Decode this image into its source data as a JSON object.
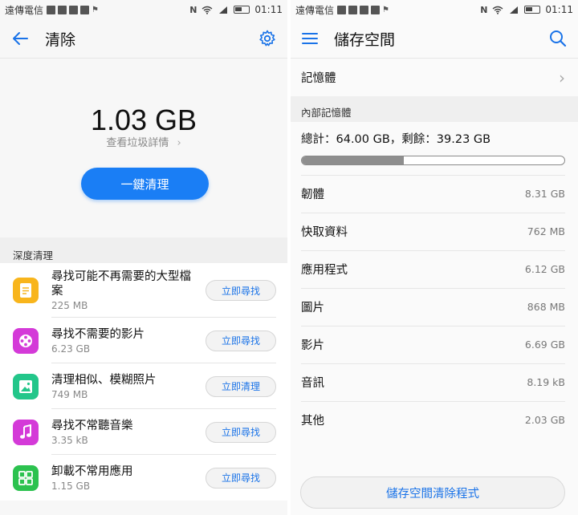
{
  "left_screen": {
    "status": {
      "carrier": "遠傳電信",
      "time": "01:11"
    },
    "appbar": {
      "title": "清除"
    },
    "summary": {
      "junk_size": "1.03 GB",
      "details_link": "查看垃圾詳情",
      "clean_button": "一鍵清理"
    },
    "deep_clean": {
      "header": "深度清理",
      "items": [
        {
          "title": "尋找可能不再需要的大型檔案",
          "size": "225 MB",
          "action": "立即尋找",
          "color": "#f8b51c",
          "icon": "document-icon"
        },
        {
          "title": "尋找不需要的影片",
          "size": "6.23 GB",
          "action": "立即尋找",
          "color": "#d43ad8",
          "icon": "film-reel-icon"
        },
        {
          "title": "清理相似、模糊照片",
          "size": "749 MB",
          "action": "立即清理",
          "color": "#23c68a",
          "icon": "photo-icon"
        },
        {
          "title": "尋找不常聽音樂",
          "size": "3.35 kB",
          "action": "立即尋找",
          "color": "#d43ad8",
          "icon": "music-note-icon"
        },
        {
          "title": "卸載不常用應用",
          "size": "1.15 GB",
          "action": "立即尋找",
          "color": "#2cc24f",
          "icon": "apps-grid-icon"
        }
      ]
    }
  },
  "right_screen": {
    "status": {
      "carrier": "遠傳電信",
      "time": "01:11"
    },
    "appbar": {
      "title": "儲存空間"
    },
    "memory_row": {
      "label": "記憶體"
    },
    "internal": {
      "header": "內部記憶體",
      "total_line": "總計：64.00 GB，剩餘：39.23 GB",
      "used_fraction": 0.387
    },
    "categories": [
      {
        "name": "韌體",
        "size": "8.31 GB"
      },
      {
        "name": "快取資料",
        "size": "762 MB"
      },
      {
        "name": "應用程式",
        "size": "6.12 GB"
      },
      {
        "name": "圖片",
        "size": "868 MB"
      },
      {
        "name": "影片",
        "size": "6.69 GB"
      },
      {
        "name": "音訊",
        "size": "8.19 kB"
      },
      {
        "name": "其他",
        "size": "2.03 GB"
      }
    ],
    "cleaner_button": "儲存空間清除程式"
  },
  "colors": {
    "accent": "#1a7ef5",
    "link": "#1a73e8"
  }
}
